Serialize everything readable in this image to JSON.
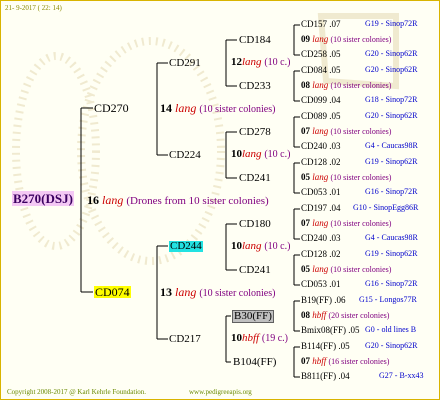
{
  "date": "21- 9-2017 ( 22: 14)",
  "root": {
    "name": "B270(DSJ)",
    "num": "16",
    "lang": "lang",
    "note": "(Drones from 10 sister colonies)"
  },
  "gen1": [
    {
      "name": "CD270",
      "num": "14",
      "lang": "lang",
      "note": "(10 sister colonies)"
    },
    {
      "name": "CD074",
      "num": "13",
      "lang": "lang",
      "note": "(10 sister colonies)"
    }
  ],
  "gen2": [
    {
      "name": "CD291",
      "num": "12",
      "lang": "lang",
      "note": "(10 c.)"
    },
    {
      "name": "CD224",
      "num": "10",
      "lang": "lang",
      "note": "(10 c.)"
    },
    {
      "name": "CD244",
      "num": "10",
      "lang": "lang",
      "note": "(10 c.)"
    },
    {
      "name": "CD217",
      "num": "10",
      "lang": "hbff",
      "note": "(19 c.)"
    }
  ],
  "gen3": [
    "CD184",
    "CD233",
    "CD278",
    "CD241",
    "CD180",
    "CD241",
    "B30(FF)",
    "B104(FF)"
  ],
  "gen4": [
    {
      "left": "CD157 .07",
      "right": "G19 - Sinop72R"
    },
    {
      "num": "09",
      "lang": "lang",
      "note": "(10 sister colonies)"
    },
    {
      "left": "CD258 .05",
      "right": "G20 - Sinop62R"
    },
    {
      "left": "CD084 .05",
      "right": "G20 - Sinop62R"
    },
    {
      "num": "08",
      "lang": "lang",
      "note": "(10 sister colonies)"
    },
    {
      "left": "CD099 .04",
      "right": "G18 - Sinop72R"
    },
    {
      "left": "CD089 .05",
      "right": "G20 - Sinop62R"
    },
    {
      "num": "07",
      "lang": "lang",
      "note": "(10 sister colonies)"
    },
    {
      "left": "CD240 .03",
      "right": "G4 - Caucas98R"
    },
    {
      "left": "CD128 .02",
      "right": "G19 - Sinop62R"
    },
    {
      "num": "05",
      "lang": "lang",
      "note": "(10 sister colonies)"
    },
    {
      "left": "CD053 .01",
      "right": "G16 - Sinop72R"
    },
    {
      "left": "CD197 .04",
      "right": "G10 - SinopEgg86R"
    },
    {
      "num": "07",
      "lang": "lang",
      "note": "(10 sister colonies)"
    },
    {
      "left": "CD240 .03",
      "right": "G4 - Caucas98R"
    },
    {
      "left": "CD128 .02",
      "right": "G19 - Sinop62R"
    },
    {
      "num": "05",
      "lang": "lang",
      "note": "(10 sister colonies)"
    },
    {
      "left": "CD053 .01",
      "right": "G16 - Sinop72R"
    },
    {
      "left": "B19(FF) .06",
      "right": "G15 - Longos77R"
    },
    {
      "num": "08",
      "lang": "hbff",
      "note": "(20 sister colonies)"
    },
    {
      "left": "Bmix08(FF) .05",
      "right": "G0 - old lines B"
    },
    {
      "left": "B114(FF) .05",
      "right": "G20 - Sinop62R"
    },
    {
      "num": "07",
      "lang": "hbff",
      "note": "(16 sister colonies)"
    },
    {
      "left": "B811(FF) .04",
      "right": "G27 - B-xx43"
    }
  ],
  "footer": {
    "copyright": "Copyright 2008-2017 @ Karl Kehrle Foundation.",
    "site": "www.pedigreeapis.org"
  },
  "colors": {
    "root_highlight": "#f4c8f4",
    "cd074_highlight": "#ffff00",
    "cd244_highlight": "#22e2e2",
    "b30_highlight": "#c0c0c0",
    "lang": "#cc0000",
    "blue": "#0000cc",
    "purple": "#800080"
  }
}
